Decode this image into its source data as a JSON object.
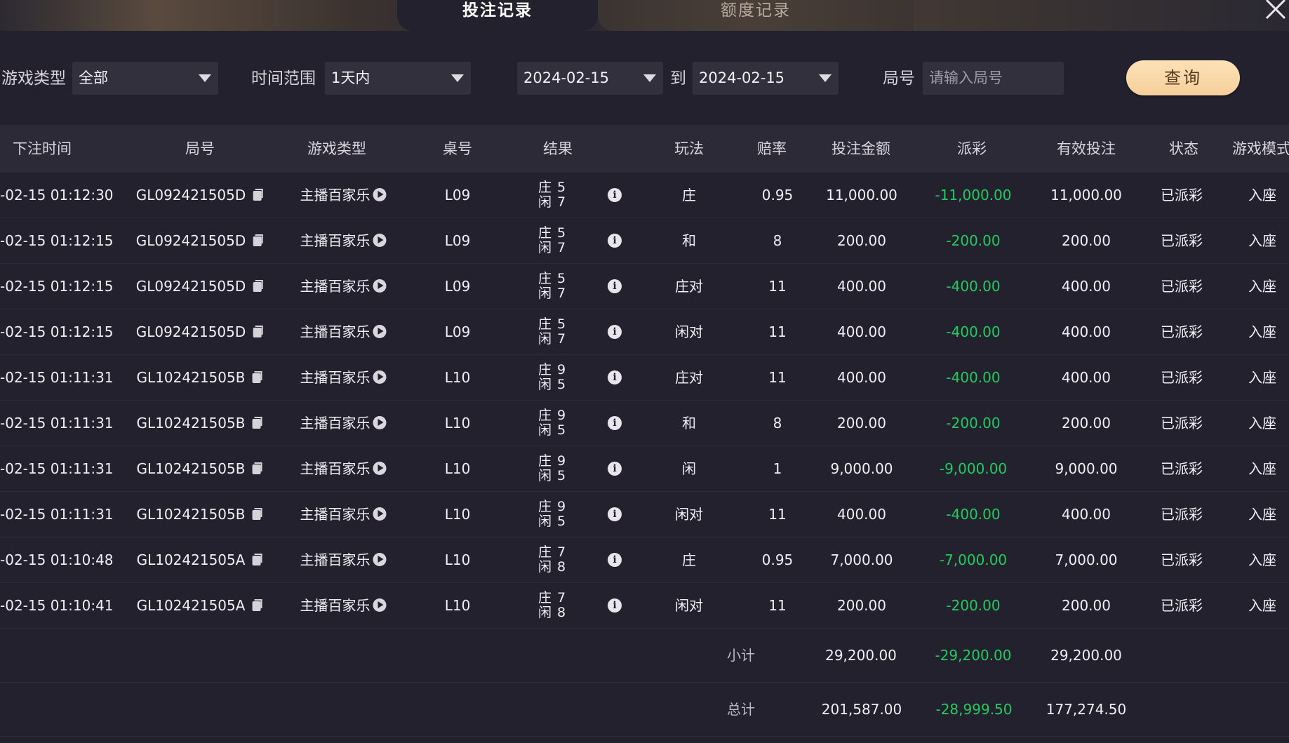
{
  "tabs": {
    "active": "投注记录",
    "inactive": "额度记录"
  },
  "filters": {
    "game_type_label": "游戏类型",
    "game_type_value": "全部",
    "time_range_label": "时间范围",
    "time_range_value": "1天内",
    "date_from": "2024-02-15",
    "date_to_label": "到",
    "date_to": "2024-02-15",
    "round_label": "局号",
    "round_placeholder": "请输入局号",
    "query_button": "查询"
  },
  "table": {
    "headers": [
      "下注时间",
      "局号",
      "游戏类型",
      "桌号",
      "结果",
      "玩法",
      "赔率",
      "投注金额",
      "派彩",
      "有效投注",
      "状态",
      "游戏模式"
    ],
    "result_labels": {
      "banker": "庄",
      "player": "闲"
    },
    "rows": [
      {
        "time": "-02-15 01:12:30",
        "round": "GL092421505D",
        "game": "主播百家乐",
        "table": "L09",
        "banker": "5",
        "player": "7",
        "bet": "庄",
        "odds": "0.95",
        "amount": "11,000.00",
        "payout": "-11,000.00",
        "valid": "11,000.00",
        "status": "已派彩",
        "mode": "入座"
      },
      {
        "time": "-02-15 01:12:15",
        "round": "GL092421505D",
        "game": "主播百家乐",
        "table": "L09",
        "banker": "5",
        "player": "7",
        "bet": "和",
        "odds": "8",
        "amount": "200.00",
        "payout": "-200.00",
        "valid": "200.00",
        "status": "已派彩",
        "mode": "入座"
      },
      {
        "time": "-02-15 01:12:15",
        "round": "GL092421505D",
        "game": "主播百家乐",
        "table": "L09",
        "banker": "5",
        "player": "7",
        "bet": "庄对",
        "odds": "11",
        "amount": "400.00",
        "payout": "-400.00",
        "valid": "400.00",
        "status": "已派彩",
        "mode": "入座"
      },
      {
        "time": "-02-15 01:12:15",
        "round": "GL092421505D",
        "game": "主播百家乐",
        "table": "L09",
        "banker": "5",
        "player": "7",
        "bet": "闲对",
        "odds": "11",
        "amount": "400.00",
        "payout": "-400.00",
        "valid": "400.00",
        "status": "已派彩",
        "mode": "入座"
      },
      {
        "time": "-02-15 01:11:31",
        "round": "GL102421505B",
        "game": "主播百家乐",
        "table": "L10",
        "banker": "9",
        "player": "5",
        "bet": "庄对",
        "odds": "11",
        "amount": "400.00",
        "payout": "-400.00",
        "valid": "400.00",
        "status": "已派彩",
        "mode": "入座"
      },
      {
        "time": "-02-15 01:11:31",
        "round": "GL102421505B",
        "game": "主播百家乐",
        "table": "L10",
        "banker": "9",
        "player": "5",
        "bet": "和",
        "odds": "8",
        "amount": "200.00",
        "payout": "-200.00",
        "valid": "200.00",
        "status": "已派彩",
        "mode": "入座"
      },
      {
        "time": "-02-15 01:11:31",
        "round": "GL102421505B",
        "game": "主播百家乐",
        "table": "L10",
        "banker": "9",
        "player": "5",
        "bet": "闲",
        "odds": "1",
        "amount": "9,000.00",
        "payout": "-9,000.00",
        "valid": "9,000.00",
        "status": "已派彩",
        "mode": "入座"
      },
      {
        "time": "-02-15 01:11:31",
        "round": "GL102421505B",
        "game": "主播百家乐",
        "table": "L10",
        "banker": "9",
        "player": "5",
        "bet": "闲对",
        "odds": "11",
        "amount": "400.00",
        "payout": "-400.00",
        "valid": "400.00",
        "status": "已派彩",
        "mode": "入座"
      },
      {
        "time": "-02-15 01:10:48",
        "round": "GL102421505A",
        "game": "主播百家乐",
        "table": "L10",
        "banker": "7",
        "player": "8",
        "bet": "庄",
        "odds": "0.95",
        "amount": "7,000.00",
        "payout": "-7,000.00",
        "valid": "7,000.00",
        "status": "已派彩",
        "mode": "入座"
      },
      {
        "time": "-02-15 01:10:41",
        "round": "GL102421505A",
        "game": "主播百家乐",
        "table": "L10",
        "banker": "7",
        "player": "8",
        "bet": "闲对",
        "odds": "11",
        "amount": "200.00",
        "payout": "-200.00",
        "valid": "200.00",
        "status": "已派彩",
        "mode": "入座"
      }
    ],
    "subtotal": {
      "label": "小计",
      "amount": "29,200.00",
      "payout": "-29,200.00",
      "valid": "29,200.00"
    },
    "total": {
      "label": "总计",
      "amount": "201,587.00",
      "payout": "-28,999.50",
      "valid": "177,274.50"
    }
  },
  "colors": {
    "background": "#24212f",
    "payout_negative": "#1fcc5e",
    "query_button": "#f6cf9a"
  },
  "icons": [
    "close-icon",
    "dropdown-caret-icon",
    "copy-icon",
    "play-icon",
    "info-icon"
  ]
}
